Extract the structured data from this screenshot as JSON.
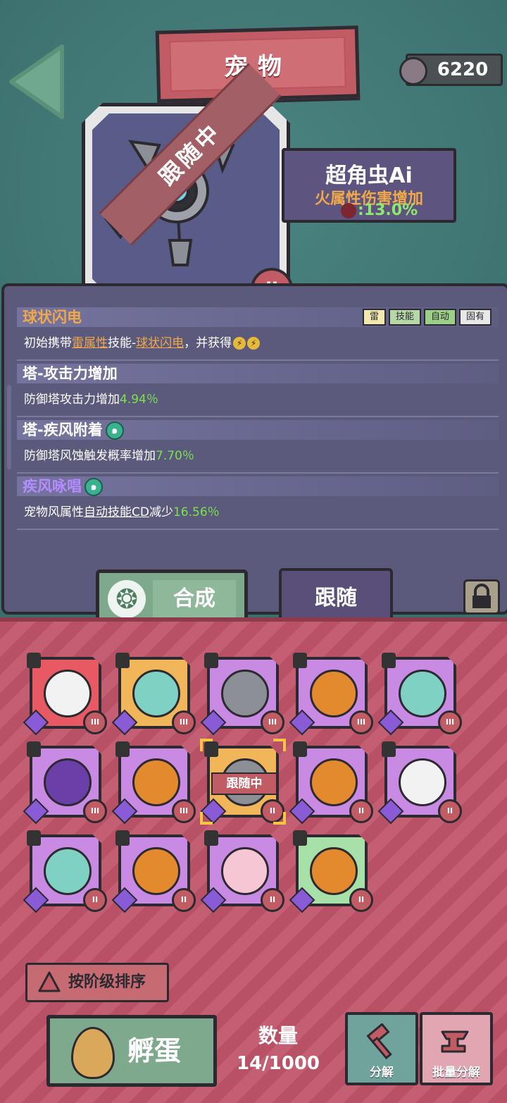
{
  "header": {
    "title": "宠物",
    "currency_value": "6220"
  },
  "pet": {
    "name": "超角虫Ai",
    "attribute": "火属性伤害增加",
    "attribute_value": ":13.0%",
    "status_ribbon": "跟随中",
    "tier": "II"
  },
  "skills": [
    {
      "title": "球状闪电",
      "tags": [
        "雷",
        "技能",
        "自动",
        "固有"
      ],
      "desc_prefix": "初始携带",
      "desc_elem": "雷属性",
      "desc_mid": "技能-",
      "desc_skill": "球状闪电",
      "desc_suffix": "，并获得"
    },
    {
      "title": "塔-攻击力增加",
      "desc": "防御塔攻击力增加",
      "value": "4.94％"
    },
    {
      "title": "塔-疾风附着",
      "desc": "防御塔风蚀触发概率增加",
      "value": "7.70％"
    },
    {
      "title": "疾风咏唱",
      "desc_prefix": "宠物风属性",
      "desc_link": "自动技能CD",
      "desc_suffix": "减少",
      "value": "16.56％"
    }
  ],
  "buttons": {
    "synthesize": "合成",
    "follow": "跟随",
    "sort": "按阶级排序",
    "hatch": "孵蛋",
    "decompose": "分解",
    "batch_decompose": "批量分解"
  },
  "inventory": {
    "count_label": "数量",
    "count_value": "14/1000",
    "following_tag": "跟随中",
    "slots": [
      {
        "pet": "skull-ghost",
        "bg": "#e85a63",
        "tier": "III"
      },
      {
        "pet": "ice-spirit",
        "bg": "#f1b55a",
        "tier": "III"
      },
      {
        "pet": "drone-bug",
        "bg": "#c98ae4",
        "tier": "III"
      },
      {
        "pet": "flame-pumpkin",
        "bg": "#c98ae4",
        "tier": "III"
      },
      {
        "pet": "ice-spirit",
        "bg": "#c98ae4",
        "tier": "III"
      },
      {
        "pet": "purple-blob",
        "bg": "#c98ae4",
        "tier": "III"
      },
      {
        "pet": "flame-pumpkin",
        "bg": "#c98ae4",
        "tier": "III"
      },
      {
        "pet": "drone-bug",
        "bg": "#f1b55a",
        "tier": "II"
      },
      {
        "pet": "flame-pumpkin",
        "bg": "#c98ae4",
        "tier": "II"
      },
      {
        "pet": "skull-ghost",
        "bg": "#c98ae4",
        "tier": "II"
      },
      {
        "pet": "ice-spirit",
        "bg": "#c98ae4",
        "tier": "II"
      },
      {
        "pet": "flame-pumpkin",
        "bg": "#c98ae4",
        "tier": "II"
      },
      {
        "pet": "fairy-girl",
        "bg": "#c98ae4",
        "tier": "II"
      },
      {
        "pet": "flame-pumpkin",
        "bg": "#a7e0a8",
        "tier": "II"
      }
    ]
  }
}
